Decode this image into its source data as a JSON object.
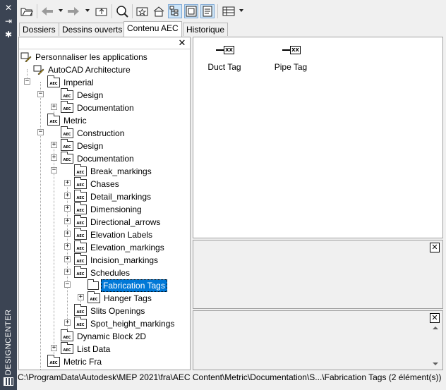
{
  "sidebar": {
    "title": "DESIGNCENTER",
    "icons": [
      "close-icon",
      "autohide-icon",
      "properties-icon",
      "designcenter-icon"
    ]
  },
  "toolbar": {
    "buttons": [
      "load-icon",
      "back-icon",
      "forward-icon",
      "up-icon",
      "search-icon",
      "favorites-icon",
      "home-icon",
      "tree-view-toggle-icon",
      "preview-icon",
      "description-icon",
      "views-icon"
    ]
  },
  "tabs": {
    "folders": "Dossiers",
    "open_drawings": "Dessins ouverts",
    "aec_content": "Contenu AEC",
    "history": "Historique",
    "active": "Contenu AEC"
  },
  "tree": {
    "root": "Personnaliser les applications",
    "app": "AutoCAD Architecture",
    "imperial": "Imperial",
    "imperial_design": "Design",
    "imperial_documentation": "Documentation",
    "metric": "Metric",
    "construction": "Construction",
    "metric_design": "Design",
    "metric_documentation": "Documentation",
    "break_markings": "Break_markings",
    "chases": "Chases",
    "detail_markings": "Detail_markings",
    "dimensioning": "Dimensioning",
    "directional_arrows": "Directional_arrows",
    "elevation_labels": "Elevation Labels",
    "elevation_markings": "Elevation_markings",
    "incision_markings": "Incision_markings",
    "schedules": "Schedules",
    "fabrication_tags": "Fabrication Tags",
    "hanger_tags": "Hanger Tags",
    "slits_openings": "Slits Openings",
    "spot_height_markings": "Spot_height_markings",
    "dynamic_block_2d": "Dynamic Block 2D",
    "list_data": "List Data",
    "metric_fra": "Metric Fra",
    "selected": "Fabrication Tags",
    "aec_icon_text": "AEC"
  },
  "content": {
    "items": [
      {
        "label": "Duct Tag",
        "glyph_text": "XX"
      },
      {
        "label": "Pipe Tag",
        "glyph_text": "XX"
      }
    ]
  },
  "status": {
    "path": "C:\\ProgramData\\Autodesk\\MEP 2021\\fra\\AEC Content\\Metric\\Documentation\\S...\\Fabrication Tags (2 élément(s))"
  },
  "colors": {
    "sidebar_bg": "#3b4453",
    "selection": "#0078d7",
    "active_toggle": "#cce4f7"
  }
}
